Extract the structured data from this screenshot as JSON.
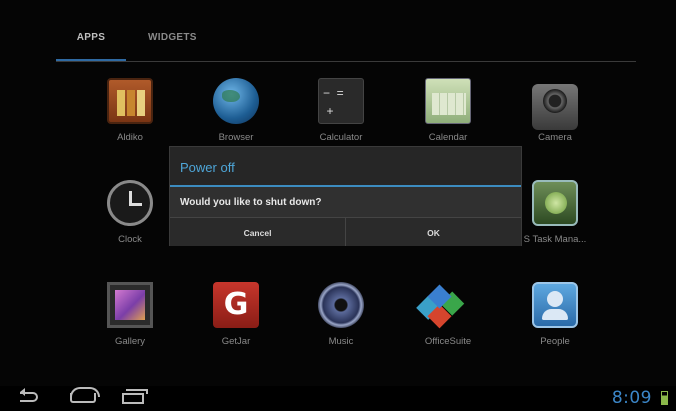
{
  "tabs": [
    {
      "label": "APPS",
      "active": true
    },
    {
      "label": "WIDGETS",
      "active": false
    }
  ],
  "apps": [
    {
      "label": "Aldiko",
      "icon": "aldiko-icon"
    },
    {
      "label": "Browser",
      "icon": "browser-icon"
    },
    {
      "label": "Calculator",
      "icon": "calculator-icon"
    },
    {
      "label": "Calendar",
      "icon": "calendar-icon"
    },
    {
      "label": "Camera",
      "icon": "camera-icon"
    },
    {
      "label": "Clock",
      "icon": "clock-icon"
    },
    {
      "label": "S Task Mana...",
      "icon": "task-manager-icon"
    },
    {
      "label": "Gallery",
      "icon": "gallery-icon"
    },
    {
      "label": "GetJar",
      "icon": "getjar-icon"
    },
    {
      "label": "Music",
      "icon": "music-icon"
    },
    {
      "label": "OfficeSuite",
      "icon": "officesuite-icon"
    },
    {
      "label": "People",
      "icon": "people-icon"
    }
  ],
  "dialog": {
    "title": "Power off",
    "message": "Would you like to shut down?",
    "cancel_label": "Cancel",
    "ok_label": "OK"
  },
  "status": {
    "time": "8:09"
  },
  "colors": {
    "accent": "#3b86c8",
    "dialog_title": "#4ea6d8",
    "battery": "#8ab84a"
  }
}
